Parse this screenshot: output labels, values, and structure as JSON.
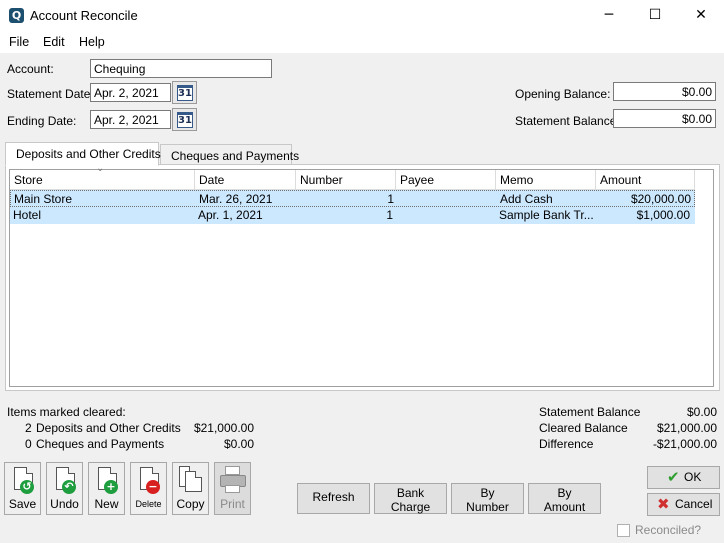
{
  "window": {
    "title": "Account Reconcile",
    "app_icon_glyph": "Q",
    "minimize_glyph": "─",
    "maximize_glyph": "☐",
    "close_glyph": "✕"
  },
  "menu": [
    "File",
    "Edit",
    "Help"
  ],
  "form": {
    "account_label": "Account:",
    "account_value": "Chequing",
    "statement_date_label": "Statement Date:",
    "statement_date_value": "Apr. 2, 2021",
    "ending_date_label": "Ending Date:",
    "ending_date_value": "Apr. 2, 2021",
    "calendar_glyph": "31",
    "opening_balance_label": "Opening Balance:",
    "opening_balance_value": "$0.00",
    "statement_balance_label": "Statement Balance:",
    "statement_balance_value": "$0.00"
  },
  "tabs": [
    {
      "label": "Deposits and Other Credits",
      "active": true
    },
    {
      "label": "Cheques and Payments",
      "active": false
    }
  ],
  "grid": {
    "sort_glyph": "⌄",
    "columns": [
      "Store",
      "Date",
      "Number",
      "Payee",
      "Memo",
      "Amount"
    ],
    "rows": [
      {
        "store": "Main Store",
        "date": "Mar. 26, 2021",
        "number": "1",
        "payee": "",
        "memo": "Add Cash",
        "amount": "$20,000.00"
      },
      {
        "store": "Hotel",
        "date": "Apr. 1, 2021",
        "number": "1",
        "payee": "",
        "memo": "Sample Bank Tr...",
        "amount": "$1,000.00"
      }
    ]
  },
  "summary": {
    "items_marked_label": "Items marked cleared:",
    "deposits_count": "2",
    "deposits_label": "Deposits and Other Credits",
    "deposits_amount": "$21,000.00",
    "cheques_count": "0",
    "cheques_label": "Cheques and Payments",
    "cheques_amount": "$0.00",
    "statement_balance_label": "Statement Balance",
    "statement_balance_value": "$0.00",
    "cleared_balance_label": "Cleared Balance",
    "cleared_balance_value": "$21,000.00",
    "difference_label": "Difference",
    "difference_value": "-$21,000.00"
  },
  "toolbar": {
    "save": "Save",
    "undo": "Undo",
    "new": "New",
    "delete": "Delete",
    "copy": "Copy",
    "print": "Print"
  },
  "actions": {
    "refresh": "Refresh",
    "bank_charge_1": "Bank",
    "bank_charge_2": "Charge",
    "by_number_1": "By",
    "by_number_2": "Number",
    "by_amount_1": "By",
    "by_amount_2": "Amount"
  },
  "dialog": {
    "ok": "OK",
    "cancel": "Cancel",
    "reconciled_label": "Reconciled?",
    "reconciled_checked": false
  },
  "colors": {
    "selection": "#cce8ff",
    "ok_check": "#2e9e2e",
    "cancel_x": "#d03030",
    "save_badge": "#1e9e3e",
    "delete_badge": "#d82020"
  }
}
